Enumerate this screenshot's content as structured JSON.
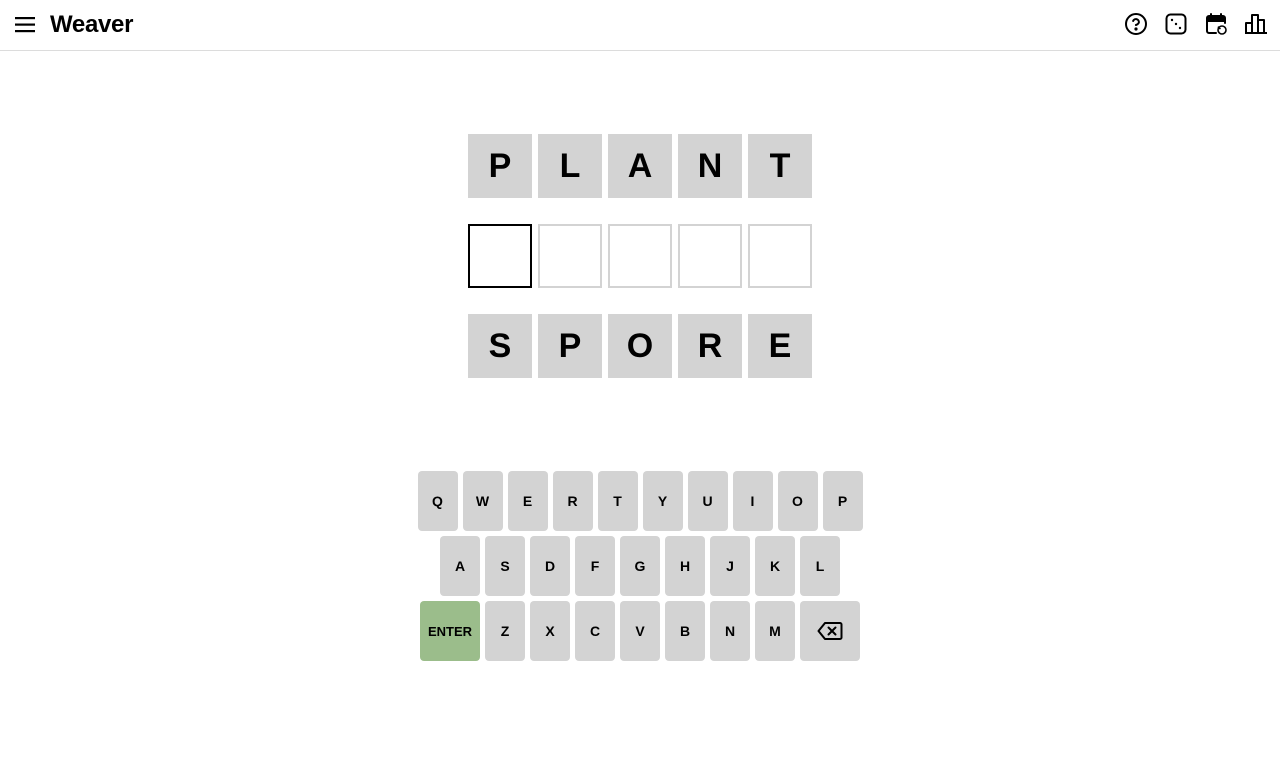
{
  "header": {
    "title": "Weaver",
    "menu_icon": "hamburger-menu-icon",
    "icons": [
      "help-circle-icon",
      "dice-icon",
      "calendar-archive-icon",
      "stats-bar-chart-icon"
    ]
  },
  "board": {
    "start_word": [
      "P",
      "L",
      "A",
      "N",
      "T"
    ],
    "guess_row": [
      "",
      "",
      "",
      "",
      ""
    ],
    "target_word": [
      "S",
      "P",
      "O",
      "R",
      "E"
    ]
  },
  "keyboard": {
    "row1": [
      "Q",
      "W",
      "E",
      "R",
      "T",
      "Y",
      "U",
      "I",
      "O",
      "P"
    ],
    "row2": [
      "A",
      "S",
      "D",
      "F",
      "G",
      "H",
      "J",
      "K",
      "L"
    ],
    "enter_label": "ENTER",
    "row3": [
      "Z",
      "X",
      "C",
      "V",
      "B",
      "N",
      "M"
    ],
    "backspace_icon": "backspace-icon"
  },
  "colors": {
    "tile_gray": "#d3d3d3",
    "enter_green": "#9bbd8b",
    "active_border": "#000000"
  }
}
